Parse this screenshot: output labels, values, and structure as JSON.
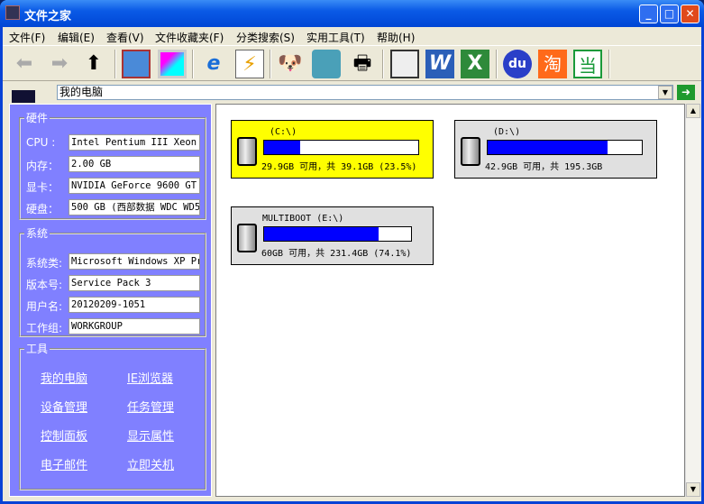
{
  "title": "文件之家",
  "window_buttons": {
    "minimize": "_",
    "maximize": "□",
    "close": "✕"
  },
  "menu": [
    "文件(F)",
    "编辑(E)",
    "查看(V)",
    "文件收藏夹(F)",
    "分类搜索(S)",
    "实用工具(T)",
    "帮助(H)"
  ],
  "toolbar": [
    "back-icon",
    "forward-icon",
    "up-icon",
    "home-icon",
    "monitor-icon",
    "ie-icon",
    "notepad-icon",
    "dog-icon",
    "folder-icon",
    "printer-icon",
    "calculator-icon",
    "word-icon",
    "excel-icon",
    "baidu-icon",
    "taobao-icon",
    "dangdang-icon"
  ],
  "toolbar_glyphs": {
    "taobao": "淘",
    "dangdang": "当",
    "baidu": "du",
    "word": "W",
    "excel": "X"
  },
  "address": "我的电脑",
  "hardware": {
    "legend": "硬件",
    "rows": [
      {
        "label": "CPU :",
        "value": "Intel Pentium III Xeon 处理器"
      },
      {
        "label": "内存：",
        "value": "2.00 GB"
      },
      {
        "label": "显卡：",
        "value": "NVIDIA GeForce 9600 GT"
      },
      {
        "label": "硬盘：",
        "value": "500 GB (西部数据 WDC WD5"
      }
    ]
  },
  "system": {
    "legend": "系统",
    "rows": [
      {
        "label": "系统类:",
        "value": "Microsoft Windows XP Pro"
      },
      {
        "label": "版本号:",
        "value": "Service Pack 3"
      },
      {
        "label": "用户名:",
        "value": "20120209-1051"
      },
      {
        "label": "工作组:",
        "value": "WORKGROUP"
      }
    ]
  },
  "tools": {
    "legend": "工具",
    "links": [
      "我的电脑",
      "IE浏览器",
      "设备管理",
      "任务管理",
      "控制面板",
      "显示属性",
      "电子邮件",
      "立即关机"
    ]
  },
  "drives": [
    {
      "name": "(C:\\)",
      "info": "29.9GB 可用，共 39.1GB (23.5%)",
      "fill": 0.235,
      "selected": true
    },
    {
      "name": "(D:\\)",
      "info": "42.9GB 可用，共 195.3GB",
      "fill": 0.78,
      "selected": false
    },
    {
      "name": "MULTIBOOT (E:\\)",
      "info": "60GB 可用，共 231.4GB (74.1%)",
      "fill": 0.78,
      "selected": false
    }
  ],
  "colors": {
    "panel": "#8080ff",
    "selected": "#ffff00",
    "bar": "#0000ff"
  }
}
